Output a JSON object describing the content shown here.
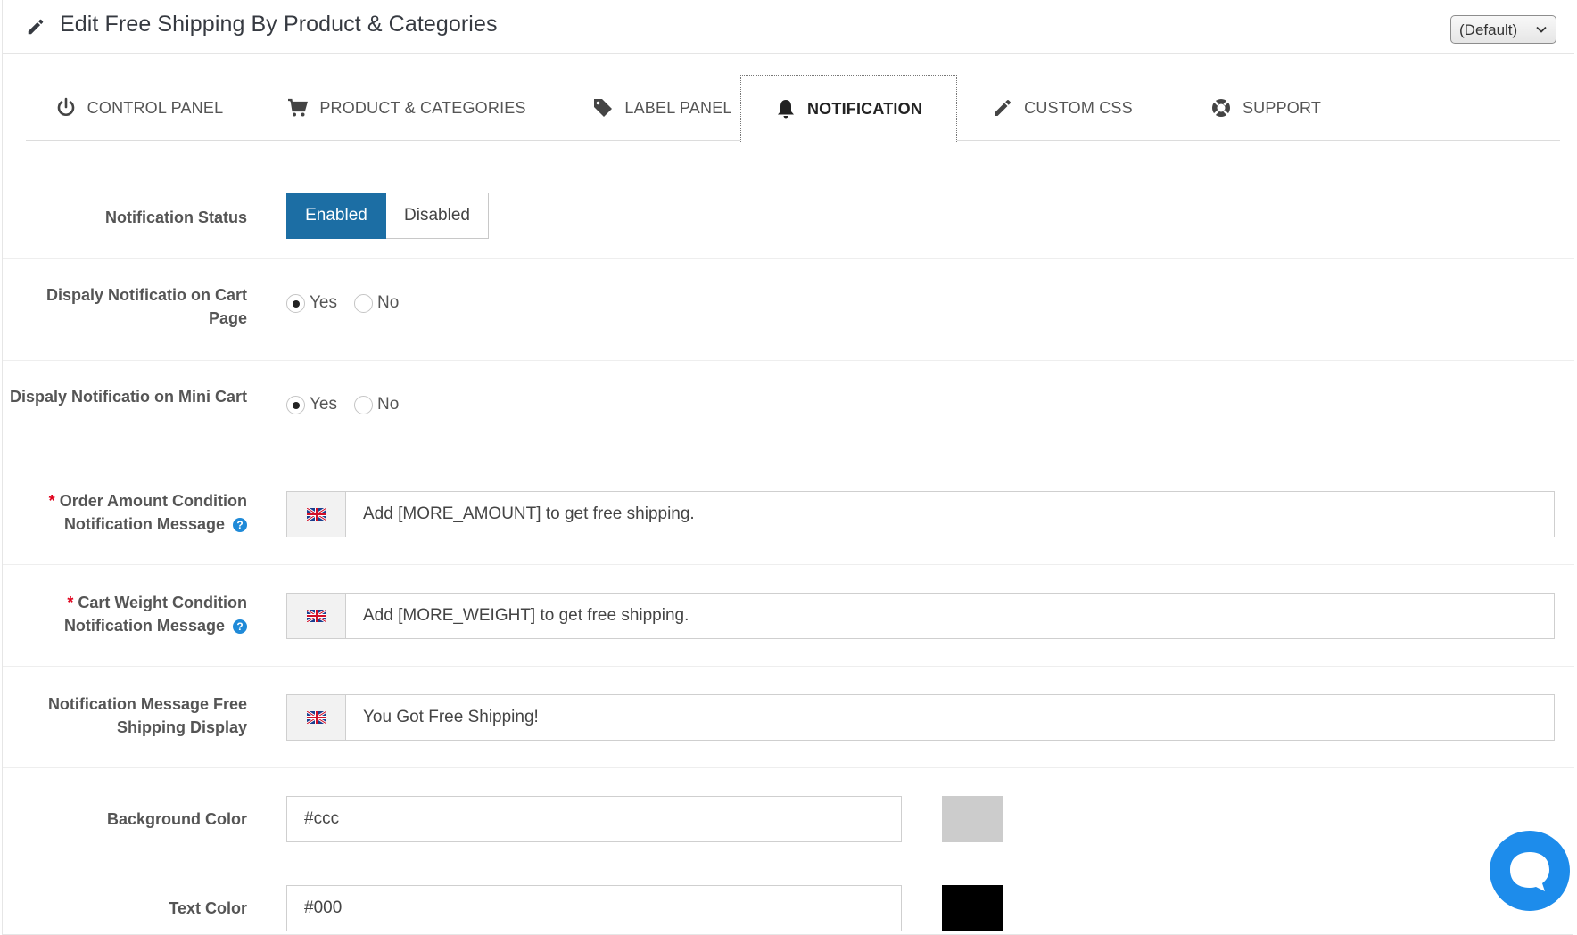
{
  "header": {
    "title": "Edit Free Shipping By Product & Categories",
    "shop_select": "(Default)"
  },
  "tabs": [
    {
      "label": "CONTROL PANEL",
      "icon": "power-icon"
    },
    {
      "label": "PRODUCT & CATEGORIES",
      "icon": "cart-icon"
    },
    {
      "label": "LABEL PANEL",
      "icon": "tag-icon"
    },
    {
      "label": "NOTIFICATION",
      "icon": "bell-icon",
      "active": true
    },
    {
      "label": "CUSTOM CSS",
      "icon": "pencil-icon"
    },
    {
      "label": "SUPPORT",
      "icon": "lifebuoy-icon"
    }
  ],
  "form": {
    "notification_status": {
      "label": "Notification Status",
      "options": [
        "Enabled",
        "Disabled"
      ],
      "selected": "Enabled"
    },
    "cart_page": {
      "label": "Dispaly Notificatio on Cart Page",
      "yes": "Yes",
      "no": "No",
      "selected": "Yes"
    },
    "mini_cart": {
      "label": "Dispaly Notificatio on Mini Cart",
      "yes": "Yes",
      "no": "No",
      "selected": "Yes"
    },
    "order_amount": {
      "required_mark": "*",
      "label": "Order Amount Condition Notification Message",
      "help": "?",
      "value": "Add [MORE_AMOUNT] to get free shipping."
    },
    "cart_weight": {
      "required_mark": "*",
      "label": "Cart Weight Condition Notification Message",
      "help": "?",
      "value": "Add [MORE_WEIGHT] to get free shipping."
    },
    "free_shipping_message": {
      "label": "Notification Message Free Shipping Display",
      "value": "You Got Free Shipping!"
    },
    "background_color": {
      "label": "Background Color",
      "value": "#ccc",
      "swatch": "#cccccc"
    },
    "text_color": {
      "label": "Text Color",
      "value": "#000",
      "swatch": "#000000"
    }
  },
  "colors": {
    "accent": "#1c6ea4",
    "chat": "#1d8ceb",
    "required": "#e0001b"
  }
}
